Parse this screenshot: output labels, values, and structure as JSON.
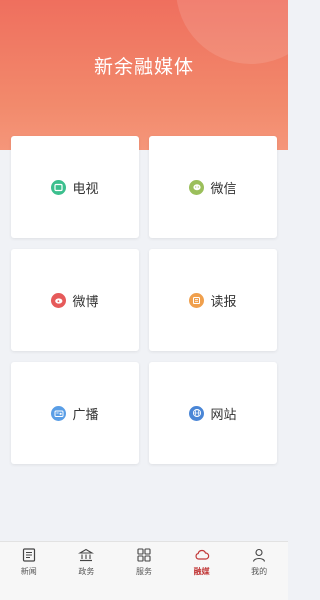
{
  "header": {
    "title": "新余融媒体"
  },
  "cards": [
    {
      "label": "电视",
      "icon": "tv-icon",
      "color": "#3cbf8e"
    },
    {
      "label": "微信",
      "icon": "wechat-icon",
      "color": "#9bbf5b"
    },
    {
      "label": "微博",
      "icon": "weibo-icon",
      "color": "#e65a5a"
    },
    {
      "label": "读报",
      "icon": "newspaper-icon",
      "color": "#f0a04d"
    },
    {
      "label": "广播",
      "icon": "radio-icon",
      "color": "#5a9ee6"
    },
    {
      "label": "网站",
      "icon": "globe-icon",
      "color": "#4a86d6"
    }
  ],
  "tabbar": {
    "tabs": [
      {
        "label": "新闻",
        "icon": "news-icon"
      },
      {
        "label": "政务",
        "icon": "government-icon"
      },
      {
        "label": "服务",
        "icon": "grid-icon"
      },
      {
        "label": "融媒",
        "icon": "cloud-icon",
        "active": true
      },
      {
        "label": "我的",
        "icon": "profile-icon"
      }
    ],
    "active_color": "#c23a3a"
  }
}
